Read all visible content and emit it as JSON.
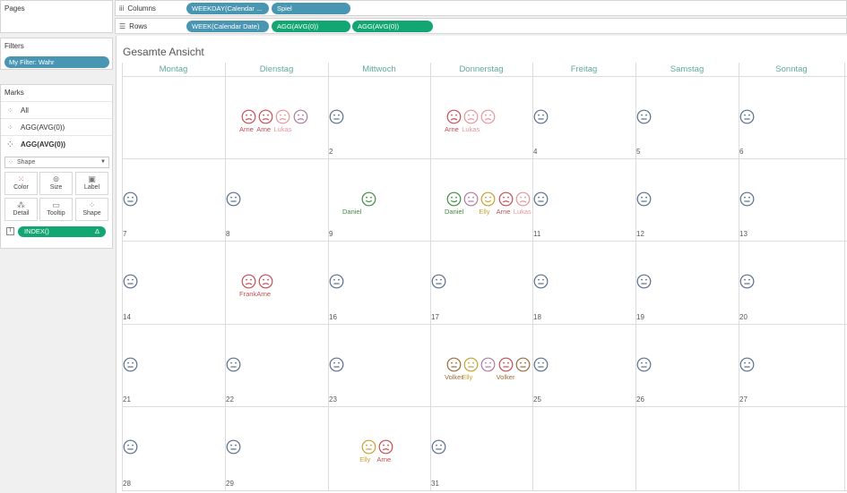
{
  "pages_title": "Pages",
  "filters": {
    "title": "Filters",
    "pill": "My Filter: Wahr"
  },
  "marks": {
    "title": "Marks",
    "rows": [
      "All",
      "AGG(AVG(0))",
      "AGG(AVG(0))"
    ],
    "mark_type": "Shape",
    "buttons": [
      "Color",
      "Size",
      "Label",
      "Detail",
      "Tooltip",
      "Shape"
    ],
    "index_pill": "INDEX()"
  },
  "shelves": {
    "columns_label": "Columns",
    "rows_label": "Rows",
    "columns_pills": [
      "WEEKDAY(Calendar ...",
      "Spiel"
    ],
    "rows_pills": [
      "WEEK(Calendar Date)",
      "AGG(AVG(0))",
      "AGG(AVG(0))"
    ]
  },
  "view": {
    "title": "Gesamte Ansicht",
    "days": [
      "Montag",
      "Dienstag",
      "Mittwoch",
      "Donnerstag",
      "Freitag",
      "Samstag",
      "Sonntag"
    ]
  },
  "colors": {
    "neutral": "#5a6f8f",
    "red": "#c44e55",
    "pink": "#e8959a",
    "green": "#3e8e41",
    "purple": "#b07aa1",
    "yellow": "#c8a030",
    "brown": "#9c6b3a",
    "pill_blue": "#4996b2",
    "pill_green": "#12a672",
    "header": "#5fa89c"
  },
  "calendar": {
    "day_numbers": [
      "2",
      "4",
      "5",
      "6",
      "7",
      "8",
      "9",
      "11",
      "12",
      "13",
      "14",
      "16",
      "17",
      "18",
      "19",
      "20",
      "21",
      "22",
      "23",
      "25",
      "26",
      "27",
      "28",
      "29",
      "31"
    ],
    "faces": [
      {
        "week": 0,
        "day": 1,
        "slot": 0,
        "color": "red",
        "mood": "sad"
      },
      {
        "week": 0,
        "day": 1,
        "slot": 1,
        "color": "red",
        "mood": "sad"
      },
      {
        "week": 0,
        "day": 1,
        "slot": 2,
        "color": "pink",
        "mood": "sad"
      },
      {
        "week": 0,
        "day": 1,
        "slot": 3,
        "color": "purple",
        "mood": "sad"
      },
      {
        "week": 0,
        "day": 2,
        "slot": 0,
        "color": "neutral",
        "mood": "neutral"
      },
      {
        "week": 0,
        "day": 3,
        "slot": 0,
        "color": "red",
        "mood": "sad"
      },
      {
        "week": 0,
        "day": 3,
        "slot": 1,
        "color": "pink",
        "mood": "sad"
      },
      {
        "week": 0,
        "day": 3,
        "slot": 2,
        "color": "pink",
        "mood": "sad"
      },
      {
        "week": 0,
        "day": 4,
        "slot": 0,
        "color": "neutral",
        "mood": "neutral"
      },
      {
        "week": 0,
        "day": 5,
        "slot": 0,
        "color": "neutral",
        "mood": "neutral"
      },
      {
        "week": 0,
        "day": 6,
        "slot": 0,
        "color": "neutral",
        "mood": "neutral"
      },
      {
        "week": 1,
        "day": 0,
        "slot": 0,
        "color": "neutral",
        "mood": "neutral"
      },
      {
        "week": 1,
        "day": 1,
        "slot": 0,
        "color": "neutral",
        "mood": "neutral"
      },
      {
        "week": 1,
        "day": 2,
        "slot": 1,
        "color": "green",
        "mood": "happy"
      },
      {
        "week": 1,
        "day": 3,
        "slot": 0,
        "color": "green",
        "mood": "happy"
      },
      {
        "week": 1,
        "day": 3,
        "slot": 1,
        "color": "purple",
        "mood": "neutral"
      },
      {
        "week": 1,
        "day": 3,
        "slot": 2,
        "color": "yellow",
        "mood": "happy"
      },
      {
        "week": 1,
        "day": 3,
        "slot": 3,
        "color": "red",
        "mood": "sad"
      },
      {
        "week": 1,
        "day": 3,
        "slot": 4,
        "color": "pink",
        "mood": "sad"
      },
      {
        "week": 1,
        "day": 4,
        "slot": 0,
        "color": "neutral",
        "mood": "neutral"
      },
      {
        "week": 1,
        "day": 5,
        "slot": 0,
        "color": "neutral",
        "mood": "neutral"
      },
      {
        "week": 1,
        "day": 6,
        "slot": 0,
        "color": "neutral",
        "mood": "neutral"
      },
      {
        "week": 2,
        "day": 0,
        "slot": 0,
        "color": "neutral",
        "mood": "neutral"
      },
      {
        "week": 2,
        "day": 1,
        "slot": 0,
        "color": "red",
        "mood": "sad"
      },
      {
        "week": 2,
        "day": 1,
        "slot": 1,
        "color": "red",
        "mood": "sad"
      },
      {
        "week": 2,
        "day": 2,
        "slot": 0,
        "color": "neutral",
        "mood": "neutral"
      },
      {
        "week": 2,
        "day": 3,
        "slot": 0,
        "color": "neutral",
        "mood": "neutral"
      },
      {
        "week": 2,
        "day": 4,
        "slot": 0,
        "color": "neutral",
        "mood": "neutral"
      },
      {
        "week": 2,
        "day": 5,
        "slot": 0,
        "color": "neutral",
        "mood": "neutral"
      },
      {
        "week": 2,
        "day": 6,
        "slot": 0,
        "color": "neutral",
        "mood": "neutral"
      },
      {
        "week": 3,
        "day": 0,
        "slot": 0,
        "color": "neutral",
        "mood": "neutral"
      },
      {
        "week": 3,
        "day": 1,
        "slot": 0,
        "color": "neutral",
        "mood": "neutral"
      },
      {
        "week": 3,
        "day": 2,
        "slot": 0,
        "color": "neutral",
        "mood": "neutral"
      },
      {
        "week": 3,
        "day": 3,
        "slot": 0,
        "color": "brown",
        "mood": "neutral"
      },
      {
        "week": 3,
        "day": 3,
        "slot": 1,
        "color": "yellow",
        "mood": "neutral"
      },
      {
        "week": 3,
        "day": 3,
        "slot": 2,
        "color": "purple",
        "mood": "neutral"
      },
      {
        "week": 3,
        "day": 3,
        "slot": 3,
        "color": "red",
        "mood": "neutral"
      },
      {
        "week": 3,
        "day": 3,
        "slot": 4,
        "color": "brown",
        "mood": "neutral"
      },
      {
        "week": 3,
        "day": 4,
        "slot": 0,
        "color": "neutral",
        "mood": "neutral"
      },
      {
        "week": 3,
        "day": 5,
        "slot": 0,
        "color": "neutral",
        "mood": "neutral"
      },
      {
        "week": 3,
        "day": 6,
        "slot": 0,
        "color": "neutral",
        "mood": "neutral"
      },
      {
        "week": 4,
        "day": 0,
        "slot": 0,
        "color": "neutral",
        "mood": "neutral"
      },
      {
        "week": 4,
        "day": 1,
        "slot": 0,
        "color": "neutral",
        "mood": "neutral"
      },
      {
        "week": 4,
        "day": 2,
        "slot": 1,
        "color": "yellow",
        "mood": "neutral"
      },
      {
        "week": 4,
        "day": 2,
        "slot": 2,
        "color": "red",
        "mood": "sad"
      },
      {
        "week": 4,
        "day": 3,
        "slot": 0,
        "color": "neutral",
        "mood": "neutral"
      }
    ],
    "labels": [
      {
        "week": 0,
        "day": 1,
        "text": "Arne",
        "color": "red",
        "offset": 0
      },
      {
        "week": 0,
        "day": 1,
        "text": "Arne",
        "color": "red",
        "offset": 1
      },
      {
        "week": 0,
        "day": 1,
        "text": "Lukas",
        "color": "pink",
        "offset": 2
      },
      {
        "week": 0,
        "day": 3,
        "text": "Arne",
        "color": "red",
        "offset": 0
      },
      {
        "week": 0,
        "day": 3,
        "text": "Lukas",
        "color": "pink",
        "offset": 1
      },
      {
        "week": 1,
        "day": 2,
        "text": "Daniel",
        "color": "green",
        "offset": 0
      },
      {
        "week": 1,
        "day": 3,
        "text": "Daniel",
        "color": "green",
        "offset": 0
      },
      {
        "week": 1,
        "day": 3,
        "text": "Elly",
        "color": "yellow",
        "offset": 2
      },
      {
        "week": 1,
        "day": 3,
        "text": "Arne",
        "color": "red",
        "offset": 3
      },
      {
        "week": 1,
        "day": 3,
        "text": "Lukas",
        "color": "pink",
        "offset": 4
      },
      {
        "week": 2,
        "day": 1,
        "text": "Frank",
        "color": "red",
        "offset": 0
      },
      {
        "week": 2,
        "day": 1,
        "text": "Arne",
        "color": "red",
        "offset": 1
      },
      {
        "week": 3,
        "day": 3,
        "text": "Volker",
        "color": "brown",
        "offset": 0
      },
      {
        "week": 3,
        "day": 3,
        "text": "Elly",
        "color": "yellow",
        "offset": 1
      },
      {
        "week": 3,
        "day": 3,
        "text": "Volker",
        "color": "brown",
        "offset": 3
      },
      {
        "week": 4,
        "day": 2,
        "text": "Elly",
        "color": "yellow",
        "offset": 1
      },
      {
        "week": 4,
        "day": 2,
        "text": "Arne",
        "color": "red",
        "offset": 2
      }
    ]
  }
}
